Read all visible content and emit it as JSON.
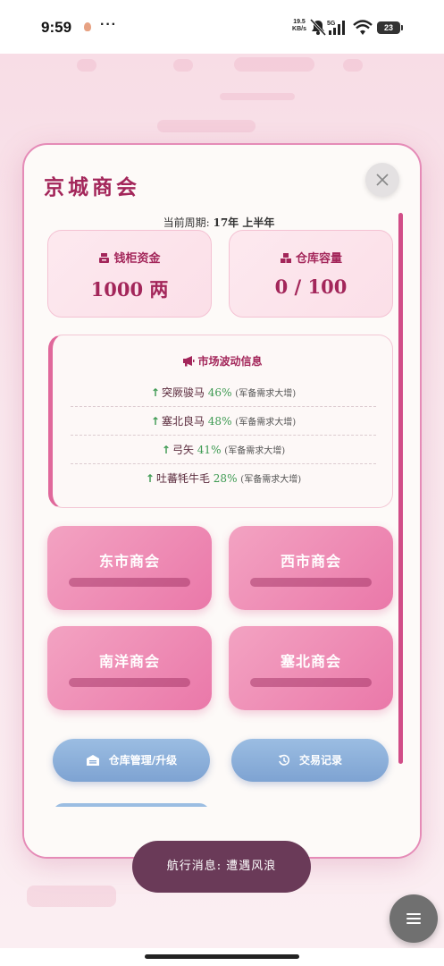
{
  "status_bar": {
    "time": "9:59",
    "more": "···",
    "net_speed_value": "19.5",
    "net_speed_unit": "KB/s",
    "signal_label": "5G",
    "battery": "23"
  },
  "modal": {
    "title": "京城商会",
    "period_label": "当前周期: ",
    "period_value": "17年 上半年",
    "stats": {
      "funds_label": "钱柜资金",
      "funds_value": "1000 两",
      "storage_label": "仓库容量",
      "storage_value": "0 / 100"
    },
    "market": {
      "title": "市场波动信息",
      "items": [
        {
          "name": "突厥骏马",
          "pct": "46%",
          "note": "(军备需求大增)"
        },
        {
          "name": "塞北良马",
          "pct": "48%",
          "note": "(军备需求大增)"
        },
        {
          "name": "弓矢",
          "pct": "41%",
          "note": "(军备需求大增)"
        },
        {
          "name": "吐蕃牦牛毛",
          "pct": "28%",
          "note": "(军备需求大增)"
        }
      ]
    },
    "guilds": [
      "东市商会",
      "西市商会",
      "南洋商会",
      "塞北商会"
    ],
    "actions": {
      "warehouse_label": "仓库管理/升级",
      "history_label": "交易记录"
    }
  },
  "toast": {
    "text": "航行消息: 遭遇风浪"
  },
  "colors": {
    "accent": "#a3265a",
    "border": "#e58bb7",
    "guild_button": "#ea78a9",
    "action_button": "#8fb1dc",
    "rise": "#3d9a52",
    "toast": "#6a3a58"
  }
}
